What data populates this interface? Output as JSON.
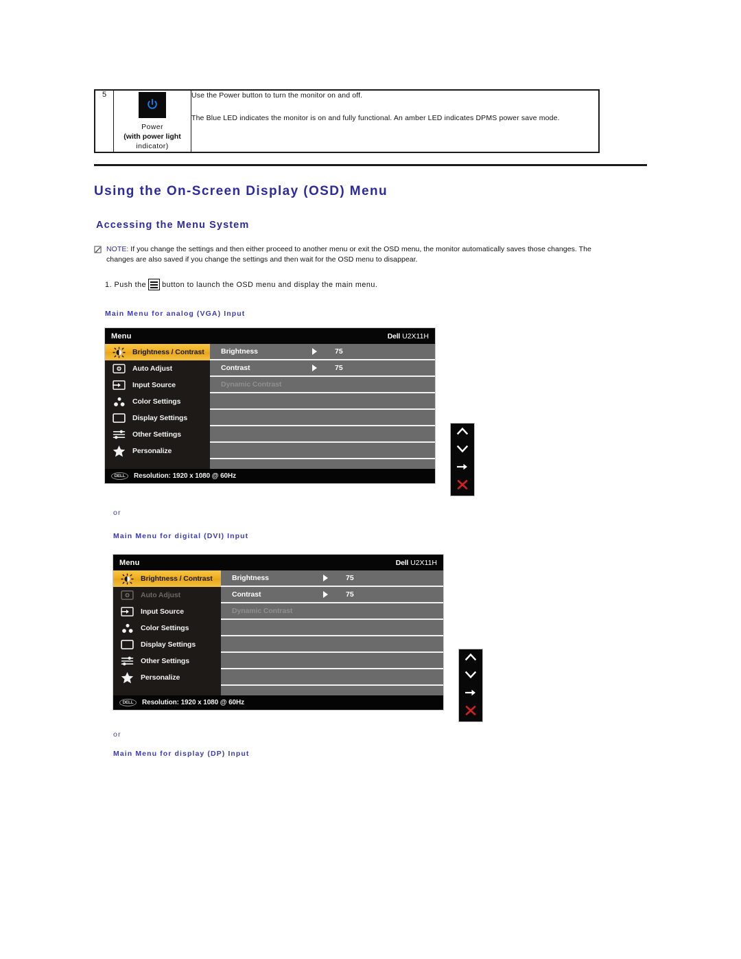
{
  "control_table": {
    "row_number": "5",
    "icon_name": "power-button-icon",
    "label_line1": "Power",
    "label_line2": "(with power light",
    "label_line3": "indicator)",
    "description_1": "Use the Power button to turn the monitor on and off.",
    "description_2": "The Blue LED indicates the monitor is on and fully functional. An amber LED indicates DPMS power save mode."
  },
  "headings": {
    "title": "Using the On-Screen Display (OSD) Menu",
    "subtitle": "Accessing the Menu System"
  },
  "note": {
    "label": "NOTE:",
    "text": " If you change the settings and then either proceed to another menu or exit the OSD menu, the monitor automatically saves those changes. The changes are also saved if you change the settings and then wait for the OSD menu to disappear."
  },
  "step": {
    "before": "1. Push the",
    "after": "button to launch the OSD menu and display the main menu."
  },
  "captions": {
    "vga": "Main Menu for analog (VGA) Input",
    "or_1": "or",
    "dvi": "Main Menu for digital (DVI) Input",
    "or_2": "or",
    "dp": "Main Menu for display (DP) Input"
  },
  "osd": {
    "header": {
      "menu": "Menu",
      "brand": "Dell",
      "model": "U2X11H"
    },
    "sidebar_vga": [
      {
        "label": "Brightness / Contrast",
        "icon": "brightness-icon",
        "state": "selected"
      },
      {
        "label": "Auto Adjust",
        "icon": "auto-adjust-icon",
        "state": "normal"
      },
      {
        "label": "Input Source",
        "icon": "input-source-icon",
        "state": "normal"
      },
      {
        "label": "Color Settings",
        "icon": "color-settings-icon",
        "state": "normal"
      },
      {
        "label": "Display Settings",
        "icon": "display-settings-icon",
        "state": "normal"
      },
      {
        "label": "Other Settings",
        "icon": "other-settings-icon",
        "state": "normal"
      },
      {
        "label": "Personalize",
        "icon": "personalize-star-icon",
        "state": "normal"
      }
    ],
    "sidebar_dvi": [
      {
        "label": "Brightness / Contrast",
        "icon": "brightness-icon",
        "state": "selected"
      },
      {
        "label": "Auto Adjust",
        "icon": "auto-adjust-icon",
        "state": "disabled"
      },
      {
        "label": "Input Source",
        "icon": "input-source-icon",
        "state": "normal"
      },
      {
        "label": "Color Settings",
        "icon": "color-settings-icon",
        "state": "normal"
      },
      {
        "label": "Display Settings",
        "icon": "display-settings-icon",
        "state": "normal"
      },
      {
        "label": "Other Settings",
        "icon": "other-settings-icon",
        "state": "normal"
      },
      {
        "label": "Personalize",
        "icon": "personalize-star-icon",
        "state": "normal"
      }
    ],
    "rows": [
      {
        "label": "Brightness",
        "value": "75",
        "state": "normal"
      },
      {
        "label": "Contrast",
        "value": "75",
        "state": "normal"
      },
      {
        "label": "Dynamic Contrast",
        "value": "",
        "state": "disabled"
      }
    ],
    "footer": {
      "logo": "DELL",
      "resolution": "Resolution: 1920 x 1080 @ 60Hz"
    },
    "nav_buttons": [
      {
        "icon": "chevron-up-icon",
        "name": "up-button"
      },
      {
        "icon": "chevron-down-icon",
        "name": "down-button"
      },
      {
        "icon": "arrow-right-icon",
        "name": "enter-button"
      },
      {
        "icon": "close-x-icon",
        "name": "exit-button"
      }
    ]
  },
  "colors": {
    "heading_blue": "#2b2b9e",
    "caption_blue": "#3b3bb0",
    "osd_highlight": "#f0ad20",
    "osd_sidebar": "#1d1a17",
    "osd_main": "#6b6b6b",
    "power_led_blue": "#1a7ae8",
    "exit_red": "#d32020"
  }
}
